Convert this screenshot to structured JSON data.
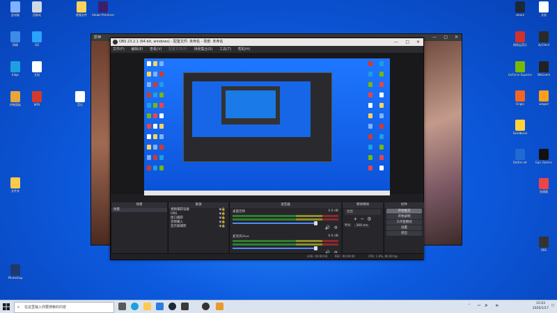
{
  "colors": {
    "desktop_top": "#2b8cff",
    "desktop_bottom": "#0741b5",
    "obs_bg": "#1f1f23",
    "obs_panel": "#26262b",
    "accent": "#4d8cff"
  },
  "desktop": {
    "left_icons": [
      {
        "label": "此电脑",
        "color": "#7fb2ff"
      },
      {
        "label": "回收站",
        "color": "#cfd8e6"
      },
      {
        "label": "视频文件",
        "color": "#ffd35a"
      },
      {
        "label": "Adobe Premiere",
        "color": "#3b1f6e"
      },
      {
        "label": "网络",
        "color": "#3c8be8"
      },
      {
        "label": "QQ",
        "color": "#2aa3ff"
      },
      {
        "label": "Edge",
        "color": "#1da0e0"
      },
      {
        "label": "文档",
        "color": "#ffffff"
      },
      {
        "label": "控制面板",
        "color": "#e7a53a"
      },
      {
        "label": "WPS",
        "color": "#d23b2c"
      },
      {
        "label": "音乐",
        "color": "#ffffff"
      },
      {
        "label": "文件夹",
        "color": "#ffc94a"
      },
      {
        "label": "Photoshop",
        "color": "#1d3a6b"
      }
    ],
    "right_icons": [
      {
        "label": "steam",
        "color": "#1b2838"
      },
      {
        "label": "文档",
        "color": "#ffffff"
      },
      {
        "label": "网易云音乐",
        "color": "#d0322b"
      },
      {
        "label": "dyClient",
        "color": "#2a2a2a"
      },
      {
        "label": "GeForce Experience",
        "color": "#76b900"
      },
      {
        "label": "WeGame",
        "color": "#222"
      },
      {
        "label": "Origin",
        "color": "#f26522"
      },
      {
        "label": "wegod",
        "color": "#ff9f1c"
      },
      {
        "label": "Sandboxie",
        "color": "#ffd23a"
      },
      {
        "label": "Battle.net",
        "color": "#1f6ad3"
      },
      {
        "label": "Epic Games",
        "color": "#111"
      },
      {
        "label": "加速器",
        "color": "#e44"
      },
      {
        "label": "OBS",
        "color": "#333"
      }
    ]
  },
  "bg_window": {
    "title": "原神"
  },
  "obs": {
    "title": "OBS 23.2.1 (64-bit, windows) - 配置文件: 未命名 - 场景: 未命名",
    "menu": [
      "文件(F)",
      "编辑(E)",
      "查看(V)",
      "配置文件(P)",
      "场景集合(S)",
      "工具(T)",
      "帮助(H)"
    ],
    "panels": {
      "scenes": {
        "header": "场景",
        "items": [
          "场景"
        ]
      },
      "sources": {
        "header": "来源",
        "items": [
          "视频捕获设备",
          "OBS",
          "窗口捕获",
          "音频输入",
          "显示器捕获"
        ]
      },
      "mixer": {
        "header": "混音器",
        "channels": [
          {
            "name": "桌面音频",
            "level": "0.0 dB"
          },
          {
            "name": "麦克风/Aux",
            "level": "0.0 dB"
          }
        ]
      },
      "transitions": {
        "header": "转场特效",
        "type": "淡出",
        "duration_label": "时长",
        "duration": "300 ms"
      },
      "controls": {
        "header": "控件",
        "buttons": [
          "开始推流",
          "开始录制",
          "工作室模式",
          "设置",
          "退出"
        ]
      }
    },
    "status": {
      "live": "LIVE: 00:00:00",
      "rec": "REC: 00:00:00",
      "cpu": "CPU: 1.0%, 60.00 fps"
    }
  },
  "taskbar": {
    "search_placeholder": "在这里输入你要搜索的内容",
    "time": "15:03",
    "date": "2020/1/17",
    "tray_lang": "中"
  }
}
